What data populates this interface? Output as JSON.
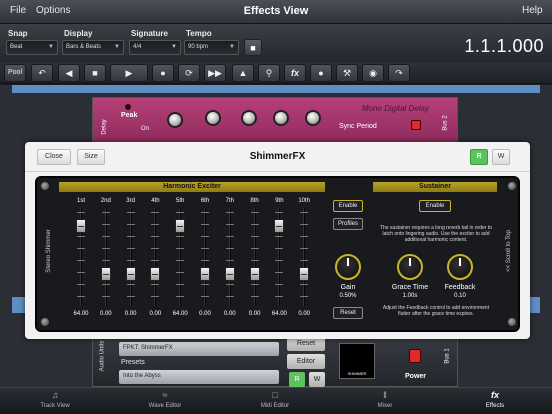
{
  "menu": {
    "file": "File",
    "options": "Options",
    "help": "Help",
    "title": "Effects View"
  },
  "controls": {
    "snap": {
      "label": "Snap",
      "value": "Beat"
    },
    "display": {
      "label": "Display",
      "value": "Bars & Beats"
    },
    "signature": {
      "label": "Signature",
      "value": "4/4"
    },
    "tempo": {
      "label": "Tempo",
      "value": "90 bpm"
    },
    "timecode": "1.1.1.000"
  },
  "transport": {
    "pool": "Pool",
    "fx": "fx"
  },
  "delay": {
    "name": "Mono Digital Delay",
    "peak": "Peak",
    "on": "On",
    "sync": "Sync Period",
    "tag": "Delay",
    "bus": "Bus 2"
  },
  "units": {
    "tag": "Audio Units",
    "plugin": "FPKT: ShimmerFX",
    "presets_label": "Presets",
    "preset": "Into the Abyss",
    "reset": "Reset",
    "editor": "Editor",
    "r": "R",
    "w": "W",
    "thumb": "SHIMMER",
    "power": "Power",
    "bus": "Bus 1"
  },
  "modal": {
    "close": "Close",
    "size": "Size",
    "title": "ShimmerFX",
    "r": "R",
    "w": "W"
  },
  "plugin": {
    "side_left": "Stereo Shimmer",
    "side_right": "<< Scroll to Top",
    "exciter_title": "Harmonic Exciter",
    "sustainer_title": "Sustainer",
    "bands": [
      {
        "label": "1st",
        "value": "64.00",
        "level": 0.87
      },
      {
        "label": "2nd",
        "value": "0.00",
        "level": 0.3
      },
      {
        "label": "3rd",
        "value": "0.00",
        "level": 0.3
      },
      {
        "label": "4th",
        "value": "0.00",
        "level": 0.3
      },
      {
        "label": "5th",
        "value": "64.00",
        "level": 0.87
      },
      {
        "label": "6th",
        "value": "0.00",
        "level": 0.3
      },
      {
        "label": "7th",
        "value": "0.00",
        "level": 0.3
      },
      {
        "label": "8th",
        "value": "0.00",
        "level": 0.3
      },
      {
        "label": "9th",
        "value": "64.00",
        "level": 0.87
      },
      {
        "label": "10th",
        "value": "0.00",
        "level": 0.3
      }
    ],
    "exciter_enable": "Enable",
    "profiles": "Profiles",
    "gain_label": "Gain",
    "gain_value": "0.50%",
    "reset": "Reset",
    "sustain_enable": "Enable",
    "sustain_desc": "The sustainer requires a long reverb tail in order to latch onto lingering audio. Use the exciter to add additional harmonic content.",
    "grace_label": "Grace Time",
    "grace_value": "1.00s",
    "feedback_label": "Feedback",
    "feedback_value": "0.10",
    "feedback_desc": "Adjust the Feedback control to add environment flutter after the grace time expires."
  },
  "tabs": [
    {
      "label": "Track View",
      "icon": "music-note-icon"
    },
    {
      "label": "Wave Editor",
      "icon": "wave-icon"
    },
    {
      "label": "Midi Editor",
      "icon": "piano-icon"
    },
    {
      "label": "Mixer",
      "icon": "mixer-icon"
    },
    {
      "label": "Effects",
      "icon": "fx-icon"
    }
  ]
}
